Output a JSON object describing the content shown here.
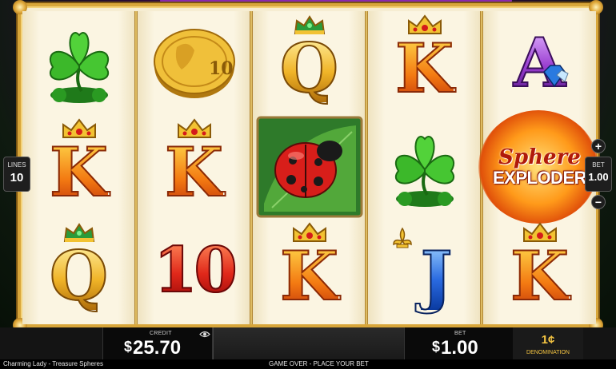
{
  "game": {
    "name": "Charming Lady - Treasure Spheres"
  },
  "reels": [
    [
      "clover",
      "K",
      "Q"
    ],
    [
      "gold-coin",
      "K",
      "10"
    ],
    [
      "Q",
      "ladybug",
      "K"
    ],
    [
      "K",
      "clover",
      "J"
    ],
    [
      "A",
      "sphere-exploder",
      "K"
    ]
  ],
  "symbols": {
    "coin_text": "10",
    "sphere_line1": "Sphere",
    "sphere_line2": "EXPLODER"
  },
  "lines": {
    "label": "LINES",
    "value": "10"
  },
  "bet_side": {
    "label": "BET",
    "value": "1.00",
    "plus": "+",
    "minus": "−"
  },
  "credit": {
    "label": "CREDIT",
    "currency": "$",
    "amount": "25.70"
  },
  "bet": {
    "label": "BET",
    "currency": "$",
    "amount": "1.00"
  },
  "denomination": {
    "value": "1¢",
    "label": "DENOMINATION"
  },
  "status": {
    "message": "GAME OVER - PLACE YOUR BET"
  },
  "colors": {
    "frame_gold": "#d8a63a",
    "reel_bg": "#fbf5e2",
    "denom_gold": "#f5c542"
  }
}
